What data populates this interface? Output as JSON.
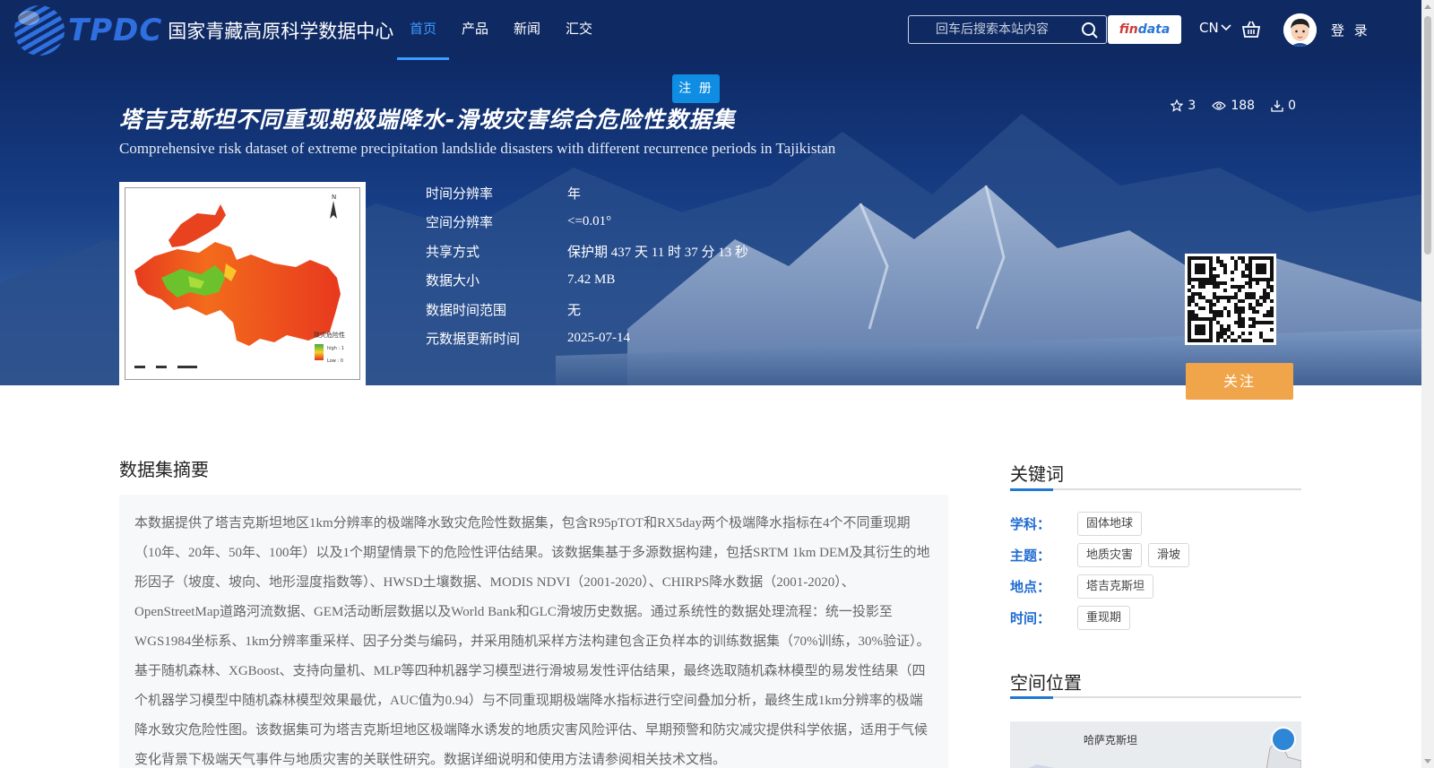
{
  "header": {
    "logo_tpdc": "TPDC",
    "logo_cn": "国家青藏高原科学数据中心",
    "nav": [
      {
        "label": "首页",
        "active": true
      },
      {
        "label": "产品",
        "active": false
      },
      {
        "label": "新闻",
        "active": false
      },
      {
        "label": "汇交",
        "active": false
      }
    ],
    "search_placeholder": "回车后搜索本站内容",
    "findata_a": "fin",
    "findata_b": "data",
    "lang": "CN",
    "login": "登 录"
  },
  "banner": {
    "register": "注 册",
    "title_cn": "塔吉克斯坦不同重现期极端降水-滑坡灾害综合危险性数据集",
    "title_en": "Comprehensive risk dataset of extreme precipitation landslide disasters with different recurrence periods in Tajikistan",
    "stats": {
      "stars": "3",
      "views": "188",
      "downloads": "0"
    },
    "meta": [
      {
        "key": "时间分辨率",
        "value": "年"
      },
      {
        "key": "空间分辨率",
        "value": "<=0.01°"
      },
      {
        "key": "共享方式",
        "value": "保护期 437 天 11 时 37 分 13 秒"
      },
      {
        "key": "数据大小",
        "value": "7.42 MB"
      },
      {
        "key": "数据时间范围",
        "value": "无"
      },
      {
        "key": "元数据更新时间",
        "value": "2025-07-14"
      }
    ],
    "thumb_legend_title": "致灾危险性",
    "thumb_legend_high": "high : 1",
    "thumb_legend_low": "Low : 0",
    "follow": "关注"
  },
  "abstract": {
    "title": "数据集摘要",
    "text": "本数据提供了塔吉克斯坦地区1km分辨率的极端降水致灾危险性数据集，包含R95pTOT和RX5day两个极端降水指标在4个不同重现期（10年、20年、50年、100年）以及1个期望情景下的危险性评估结果。该数据集基于多源数据构建，包括SRTM 1km DEM及其衍生的地形因子（坡度、坡向、地形湿度指数等）、HWSD土壤数据、MODIS NDVI（2001-2020）、CHIRPS降水数据（2001-2020）、OpenStreetMap道路河流数据、GEM活动断层数据以及World Bank和GLC滑坡历史数据。通过系统性的数据处理流程：统一投影至WGS1984坐标系、1km分辨率重采样、因子分类与编码，并采用随机采样方法构建包含正负样本的训练数据集（70%训练，30%验证）。基于随机森林、XGBoost、支持向量机、MLP等四种机器学习模型进行滑坡易发性评估结果，最终选取随机森林模型的易发性结果（四个机器学习模型中随机森林模型效果最优，AUC值为0.94）与不同重现期极端降水指标进行空间叠加分析，最终生成1km分辨率的极端降水致灾危险性图。该数据集可为塔吉克斯坦地区极端降水诱发的地质灾害风险评估、早期预警和防灾减灾提供科学依据，适用于气候变化背景下极端天气事件与地质灾害的关联性研究。数据详细说明和使用方法请参阅相关技术文档。"
  },
  "sidebar": {
    "keywords_title": "关键词",
    "rows": [
      {
        "label": "学科：",
        "tags": [
          "固体地球"
        ]
      },
      {
        "label": "主题：",
        "tags": [
          "地质灾害",
          "滑坡"
        ]
      },
      {
        "label": "地点：",
        "tags": [
          "塔吉克斯坦"
        ]
      },
      {
        "label": "时间：",
        "tags": [
          "重现期"
        ]
      }
    ],
    "location_title": "空间位置",
    "map_label": "哈萨克斯坦"
  }
}
